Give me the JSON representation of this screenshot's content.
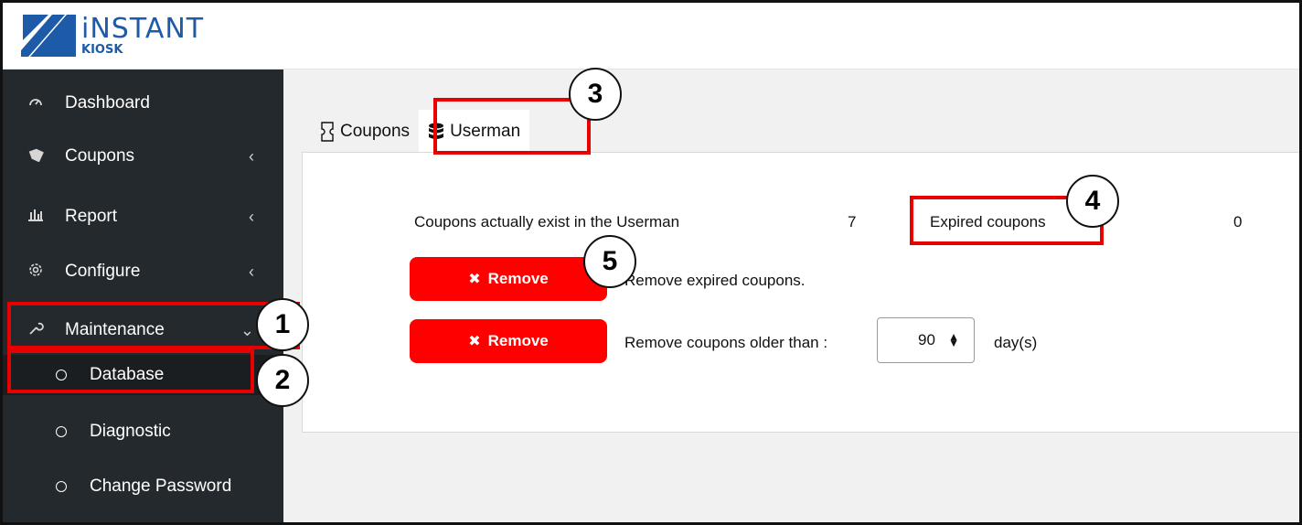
{
  "brand": {
    "name": "iNSTANT",
    "sub": "KIOSK",
    "color": "#1d5aa8"
  },
  "sidebar": {
    "items": [
      {
        "label": "Dashboard",
        "icon": "gauge-icon",
        "arrow": ""
      },
      {
        "label": "Coupons",
        "icon": "tag-icon",
        "arrow": "‹"
      },
      {
        "label": "Report",
        "icon": "bar-chart-icon",
        "arrow": "‹"
      },
      {
        "label": "Configure",
        "icon": "gear-icon",
        "arrow": "‹"
      },
      {
        "label": "Maintenance",
        "icon": "wrench-icon",
        "arrow": "⌄"
      }
    ],
    "subitems": [
      {
        "label": "Database"
      },
      {
        "label": "Diagnostic"
      },
      {
        "label": "Change Password"
      }
    ]
  },
  "tabs": [
    {
      "label": "Coupons",
      "icon": "ticket-icon"
    },
    {
      "label": "Userman",
      "icon": "database-icon"
    }
  ],
  "panel": {
    "exist_label": "Coupons actually exist in the Userman",
    "exist_count": "7",
    "expired_label": "Expired coupons",
    "expired_count": "0",
    "remove_label": "Remove",
    "remove_expired_desc": "Remove expired coupons.",
    "remove_older_desc": "Remove coupons older than :",
    "days_value": "90",
    "days_unit": "day(s)"
  },
  "annotations": [
    "1",
    "2",
    "3",
    "4",
    "5"
  ],
  "colors": {
    "sidebar_bg": "#24292d",
    "accent_red": "#ff0000",
    "highlight": "#e60000"
  }
}
